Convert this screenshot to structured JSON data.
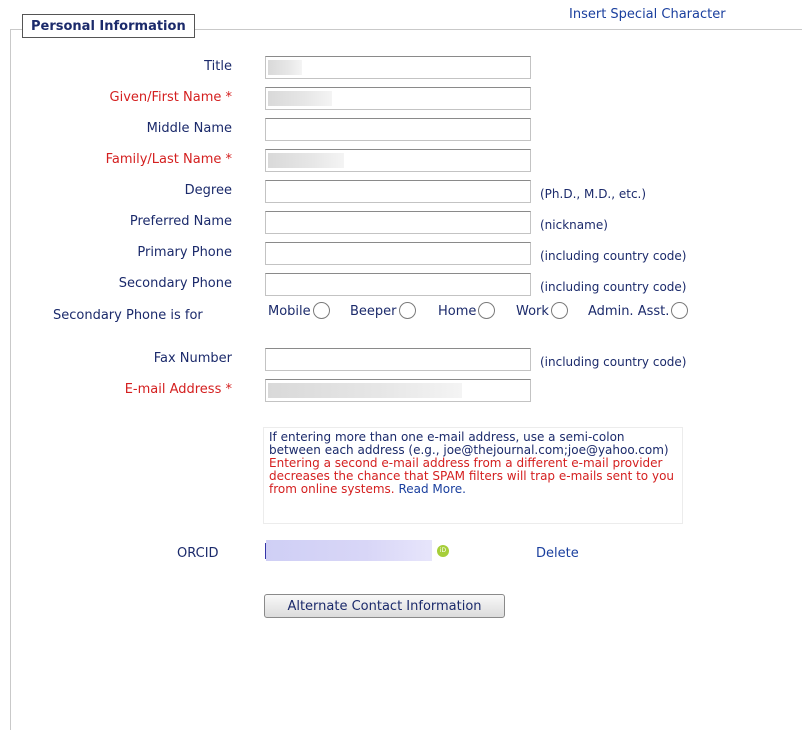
{
  "header": {
    "section_title": "Personal Information",
    "special_char_link": "Insert Special Character"
  },
  "fields": [
    {
      "label": "Title",
      "required": false,
      "value": "",
      "hint": ""
    },
    {
      "label": "Given/First Name",
      "required": true,
      "value": "",
      "hint": ""
    },
    {
      "label": "Middle Name",
      "required": false,
      "value": "",
      "hint": ""
    },
    {
      "label": "Family/Last Name",
      "required": true,
      "value": "",
      "hint": ""
    },
    {
      "label": "Degree",
      "required": false,
      "value": "",
      "hint": "(Ph.D., M.D., etc.)"
    },
    {
      "label": "Preferred Name",
      "required": false,
      "value": "",
      "hint": "(nickname)"
    },
    {
      "label": "Primary Phone",
      "required": false,
      "value": "",
      "hint": "(including country code)"
    },
    {
      "label": "Secondary Phone",
      "required": false,
      "value": "",
      "hint": "(including country code)"
    }
  ],
  "secondary_phone_for": {
    "label": "Secondary Phone is for",
    "options": [
      "Mobile",
      "Beeper",
      "Home",
      "Work",
      "Admin. Asst."
    ]
  },
  "fax": {
    "label": "Fax Number",
    "value": "",
    "hint": "(including country code)"
  },
  "email": {
    "label": "E-mail Address",
    "required_marker": "*",
    "value": ""
  },
  "required_marker": "*",
  "email_note": {
    "info": "If entering more than one e-mail address, use a semi-colon between each address (e.g., joe@thejournal.com;joe@yahoo.com)",
    "warning": "Entering a second e-mail address from a different e-mail provider decreases the chance that SPAM filters will trap e-mails sent to you from online systems.",
    "read_more": "Read More."
  },
  "orcid": {
    "label": "ORCID",
    "delete_label": "Delete",
    "icon_text": "iD"
  },
  "alternate_contact_button": "Alternate Contact Information"
}
